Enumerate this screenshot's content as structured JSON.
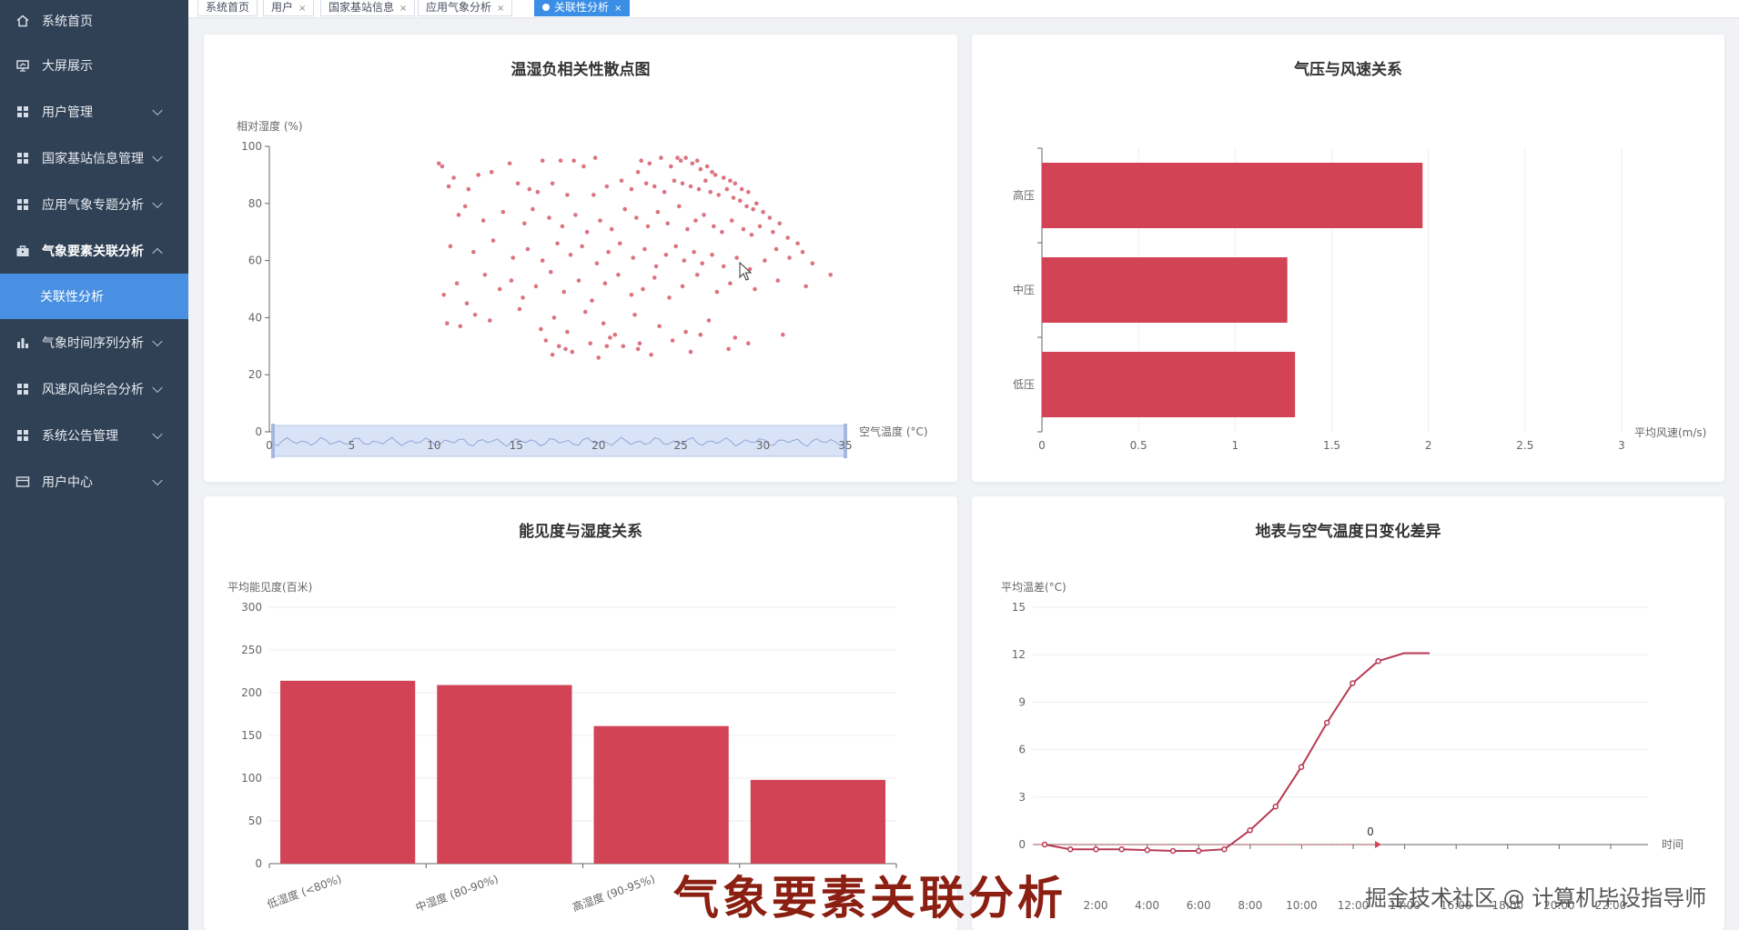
{
  "sidebar": {
    "items": [
      {
        "label": "系统首页",
        "icon": "home-icon",
        "expand": false
      },
      {
        "label": "大屏展示",
        "icon": "screen-icon",
        "expand": false
      },
      {
        "label": "用户管理",
        "icon": "grid-icon",
        "expand": true
      },
      {
        "label": "国家基站信息管理",
        "icon": "grid-icon",
        "expand": true
      },
      {
        "label": "应用气象专题分析",
        "icon": "grid-icon",
        "expand": true
      },
      {
        "label": "气象要素关联分析",
        "icon": "briefcase-icon",
        "expand": true,
        "open": true
      },
      {
        "label": "气象时间序列分析",
        "icon": "bar-chart-icon",
        "expand": true
      },
      {
        "label": "风速风向综合分析",
        "icon": "grid-icon",
        "expand": true
      },
      {
        "label": "系统公告管理",
        "icon": "grid-icon",
        "expand": true
      },
      {
        "label": "用户中心",
        "icon": "user-card-icon",
        "expand": true
      }
    ],
    "active_sub": "关联性分析"
  },
  "tabs": [
    {
      "label": "系统首页",
      "closable": false
    },
    {
      "label": "用户",
      "closable": true
    },
    {
      "label": "国家基站信息",
      "closable": true
    },
    {
      "label": "应用气象分析",
      "closable": true
    },
    {
      "label": "关联性分析",
      "closable": true,
      "active": true
    }
  ],
  "overlay": {
    "watermark": "气象要素关联分析",
    "credit": "掘金技术社区 @ 计算机毕设指导师"
  },
  "colors": {
    "accent": "#d24455",
    "sidebar_bg": "#304156",
    "active_blue": "#4a90e2"
  },
  "chart_data": [
    {
      "type": "scatter",
      "title": "温湿负相关性散点图",
      "xlabel": "空气温度 (°C)",
      "ylabel": "相对湿度 (%)",
      "xlim": [
        0,
        35
      ],
      "ylim": [
        0,
        100
      ],
      "x_ticks": [
        "0",
        "5",
        "10",
        "15",
        "20",
        "25",
        "30",
        "35"
      ],
      "y_ticks": [
        "0",
        "20",
        "40",
        "60",
        "80",
        "100"
      ],
      "points": [
        [
          10.3,
          94
        ],
        [
          10.5,
          93
        ],
        [
          12.7,
          90
        ],
        [
          13.5,
          91
        ],
        [
          14.6,
          94
        ],
        [
          16.6,
          95
        ],
        [
          17.7,
          95
        ],
        [
          18.5,
          95
        ],
        [
          19.1,
          93
        ],
        [
          19.8,
          96
        ],
        [
          22.4,
          91
        ],
        [
          22.6,
          95
        ],
        [
          23.1,
          94
        ],
        [
          23.8,
          96
        ],
        [
          24.4,
          93
        ],
        [
          24.8,
          96
        ],
        [
          25.0,
          95
        ],
        [
          25.3,
          96
        ],
        [
          25.7,
          94
        ],
        [
          26.0,
          95
        ],
        [
          26.2,
          92
        ],
        [
          26.6,
          93
        ],
        [
          26.9,
          91
        ],
        [
          27.1,
          90
        ],
        [
          27.6,
          89
        ],
        [
          28.0,
          88
        ],
        [
          28.3,
          87
        ],
        [
          28.7,
          85
        ],
        [
          29.1,
          84
        ],
        [
          29.6,
          80
        ],
        [
          10.9,
          86
        ],
        [
          11.2,
          89
        ],
        [
          12.1,
          85
        ],
        [
          15.1,
          87
        ],
        [
          15.8,
          85
        ],
        [
          16.3,
          84
        ],
        [
          17.2,
          87
        ],
        [
          18.1,
          83
        ],
        [
          19.7,
          83
        ],
        [
          20.5,
          86
        ],
        [
          21.4,
          88
        ],
        [
          22.0,
          85
        ],
        [
          22.9,
          87
        ],
        [
          23.4,
          86
        ],
        [
          24.0,
          84
        ],
        [
          24.6,
          88
        ],
        [
          25.1,
          87
        ],
        [
          25.6,
          86
        ],
        [
          26.1,
          85
        ],
        [
          26.5,
          88
        ],
        [
          26.8,
          84
        ],
        [
          27.3,
          83
        ],
        [
          27.8,
          85
        ],
        [
          28.2,
          82
        ],
        [
          28.6,
          81
        ],
        [
          29.0,
          79
        ],
        [
          29.4,
          78
        ],
        [
          30.0,
          77
        ],
        [
          30.4,
          75
        ],
        [
          31.0,
          73
        ],
        [
          11.5,
          76
        ],
        [
          11.9,
          79
        ],
        [
          13.0,
          74
        ],
        [
          14.2,
          77
        ],
        [
          15.5,
          73
        ],
        [
          16.0,
          78
        ],
        [
          17.0,
          75
        ],
        [
          17.8,
          72
        ],
        [
          18.6,
          76
        ],
        [
          19.3,
          70
        ],
        [
          20.1,
          74
        ],
        [
          20.8,
          71
        ],
        [
          21.6,
          78
        ],
        [
          22.3,
          75
        ],
        [
          23.0,
          72
        ],
        [
          23.6,
          77
        ],
        [
          24.2,
          73
        ],
        [
          24.9,
          79
        ],
        [
          25.4,
          71
        ],
        [
          25.9,
          74
        ],
        [
          26.4,
          76
        ],
        [
          27.0,
          72
        ],
        [
          27.5,
          70
        ],
        [
          28.1,
          74
        ],
        [
          28.8,
          71
        ],
        [
          29.3,
          69
        ],
        [
          29.8,
          72
        ],
        [
          30.6,
          70
        ],
        [
          31.5,
          68
        ],
        [
          32.1,
          66
        ],
        [
          11.0,
          65
        ],
        [
          12.4,
          63
        ],
        [
          13.6,
          67
        ],
        [
          14.8,
          61
        ],
        [
          15.7,
          64
        ],
        [
          16.6,
          60
        ],
        [
          17.5,
          66
        ],
        [
          18.3,
          62
        ],
        [
          19.0,
          65
        ],
        [
          19.9,
          59
        ],
        [
          20.6,
          63
        ],
        [
          21.3,
          66
        ],
        [
          22.1,
          61
        ],
        [
          22.8,
          64
        ],
        [
          23.5,
          58
        ],
        [
          24.1,
          62
        ],
        [
          24.7,
          65
        ],
        [
          25.2,
          60
        ],
        [
          25.8,
          63
        ],
        [
          26.3,
          59
        ],
        [
          26.9,
          62
        ],
        [
          27.6,
          58
        ],
        [
          28.4,
          61
        ],
        [
          29.2,
          57
        ],
        [
          30.1,
          60
        ],
        [
          30.8,
          64
        ],
        [
          31.6,
          61
        ],
        [
          32.4,
          63
        ],
        [
          33.0,
          59
        ],
        [
          34.1,
          55
        ],
        [
          10.6,
          48
        ],
        [
          11.4,
          52
        ],
        [
          12.0,
          45
        ],
        [
          13.1,
          55
        ],
        [
          14.0,
          50
        ],
        [
          14.7,
          53
        ],
        [
          15.4,
          47
        ],
        [
          16.2,
          51
        ],
        [
          17.1,
          56
        ],
        [
          17.9,
          49
        ],
        [
          18.8,
          53
        ],
        [
          19.6,
          46
        ],
        [
          20.4,
          52
        ],
        [
          21.2,
          55
        ],
        [
          22.0,
          48
        ],
        [
          22.7,
          50
        ],
        [
          23.4,
          54
        ],
        [
          24.3,
          47
        ],
        [
          25.1,
          51
        ],
        [
          26.0,
          55
        ],
        [
          27.2,
          49
        ],
        [
          28.0,
          52
        ],
        [
          29.5,
          50
        ],
        [
          30.9,
          53
        ],
        [
          32.6,
          51
        ],
        [
          10.8,
          38
        ],
        [
          11.6,
          37
        ],
        [
          12.5,
          41
        ],
        [
          13.4,
          39
        ],
        [
          15.2,
          43
        ],
        [
          16.5,
          36
        ],
        [
          17.3,
          40
        ],
        [
          18.1,
          35
        ],
        [
          19.2,
          42
        ],
        [
          20.3,
          38
        ],
        [
          21.0,
          34
        ],
        [
          22.2,
          41
        ],
        [
          23.7,
          37
        ],
        [
          25.3,
          35
        ],
        [
          26.7,
          39
        ],
        [
          16.8,
          32
        ],
        [
          17.6,
          30
        ],
        [
          18.4,
          28
        ],
        [
          19.5,
          31
        ],
        [
          20.7,
          33
        ],
        [
          21.5,
          30
        ],
        [
          22.4,
          29
        ],
        [
          24.5,
          32
        ],
        [
          26.2,
          34
        ],
        [
          28.3,
          33
        ],
        [
          17.2,
          27
        ],
        [
          18.0,
          29
        ],
        [
          20.0,
          26
        ],
        [
          20.5,
          30
        ],
        [
          22.5,
          31
        ],
        [
          23.2,
          27
        ],
        [
          25.6,
          28
        ],
        [
          27.9,
          29
        ],
        [
          29.1,
          31
        ],
        [
          31.2,
          34
        ]
      ]
    },
    {
      "type": "bar",
      "orientation": "horizontal",
      "title": "气压与风速关系",
      "xlabel": "平均风速(m/s)",
      "categories": [
        "高压",
        "中压",
        "低压"
      ],
      "values": [
        1.97,
        1.27,
        1.31
      ],
      "xlim": [
        0,
        3
      ],
      "x_ticks": [
        "0",
        "0.5",
        "1",
        "1.5",
        "2",
        "2.5",
        "3"
      ]
    },
    {
      "type": "bar",
      "title": "能见度与湿度关系",
      "ylabel": "平均能见度(百米)",
      "categories": [
        "低湿度 (<80%)",
        "中湿度 (80-90%)",
        "高湿度 (90-95%)",
        ""
      ],
      "values": [
        214,
        209,
        161,
        98
      ],
      "ylim": [
        0,
        300
      ],
      "y_ticks": [
        "0",
        "50",
        "100",
        "150",
        "200",
        "250",
        "300"
      ]
    },
    {
      "type": "line",
      "title": "地表与空气温度日变化差异",
      "ylabel": "平均温差(°C)",
      "xlabel": "时间",
      "ylim": [
        0,
        15
      ],
      "y_ticks": [
        "0",
        "3",
        "6",
        "9",
        "12",
        "15"
      ],
      "x_ticks": [
        "2:00",
        "4:00",
        "6:00",
        "8:00",
        "10:00",
        "12:00",
        "14:00",
        "16:00",
        "18:00",
        "20:00",
        "22:00"
      ],
      "series": [
        {
          "values": [
            0,
            -0.3,
            -0.3,
            -0.3,
            -0.35,
            -0.4,
            -0.4,
            -0.3,
            0.9,
            2.4,
            4.9,
            7.7,
            10.2,
            11.6,
            12.1,
            12.1
          ]
        }
      ],
      "annotation": "0"
    }
  ]
}
